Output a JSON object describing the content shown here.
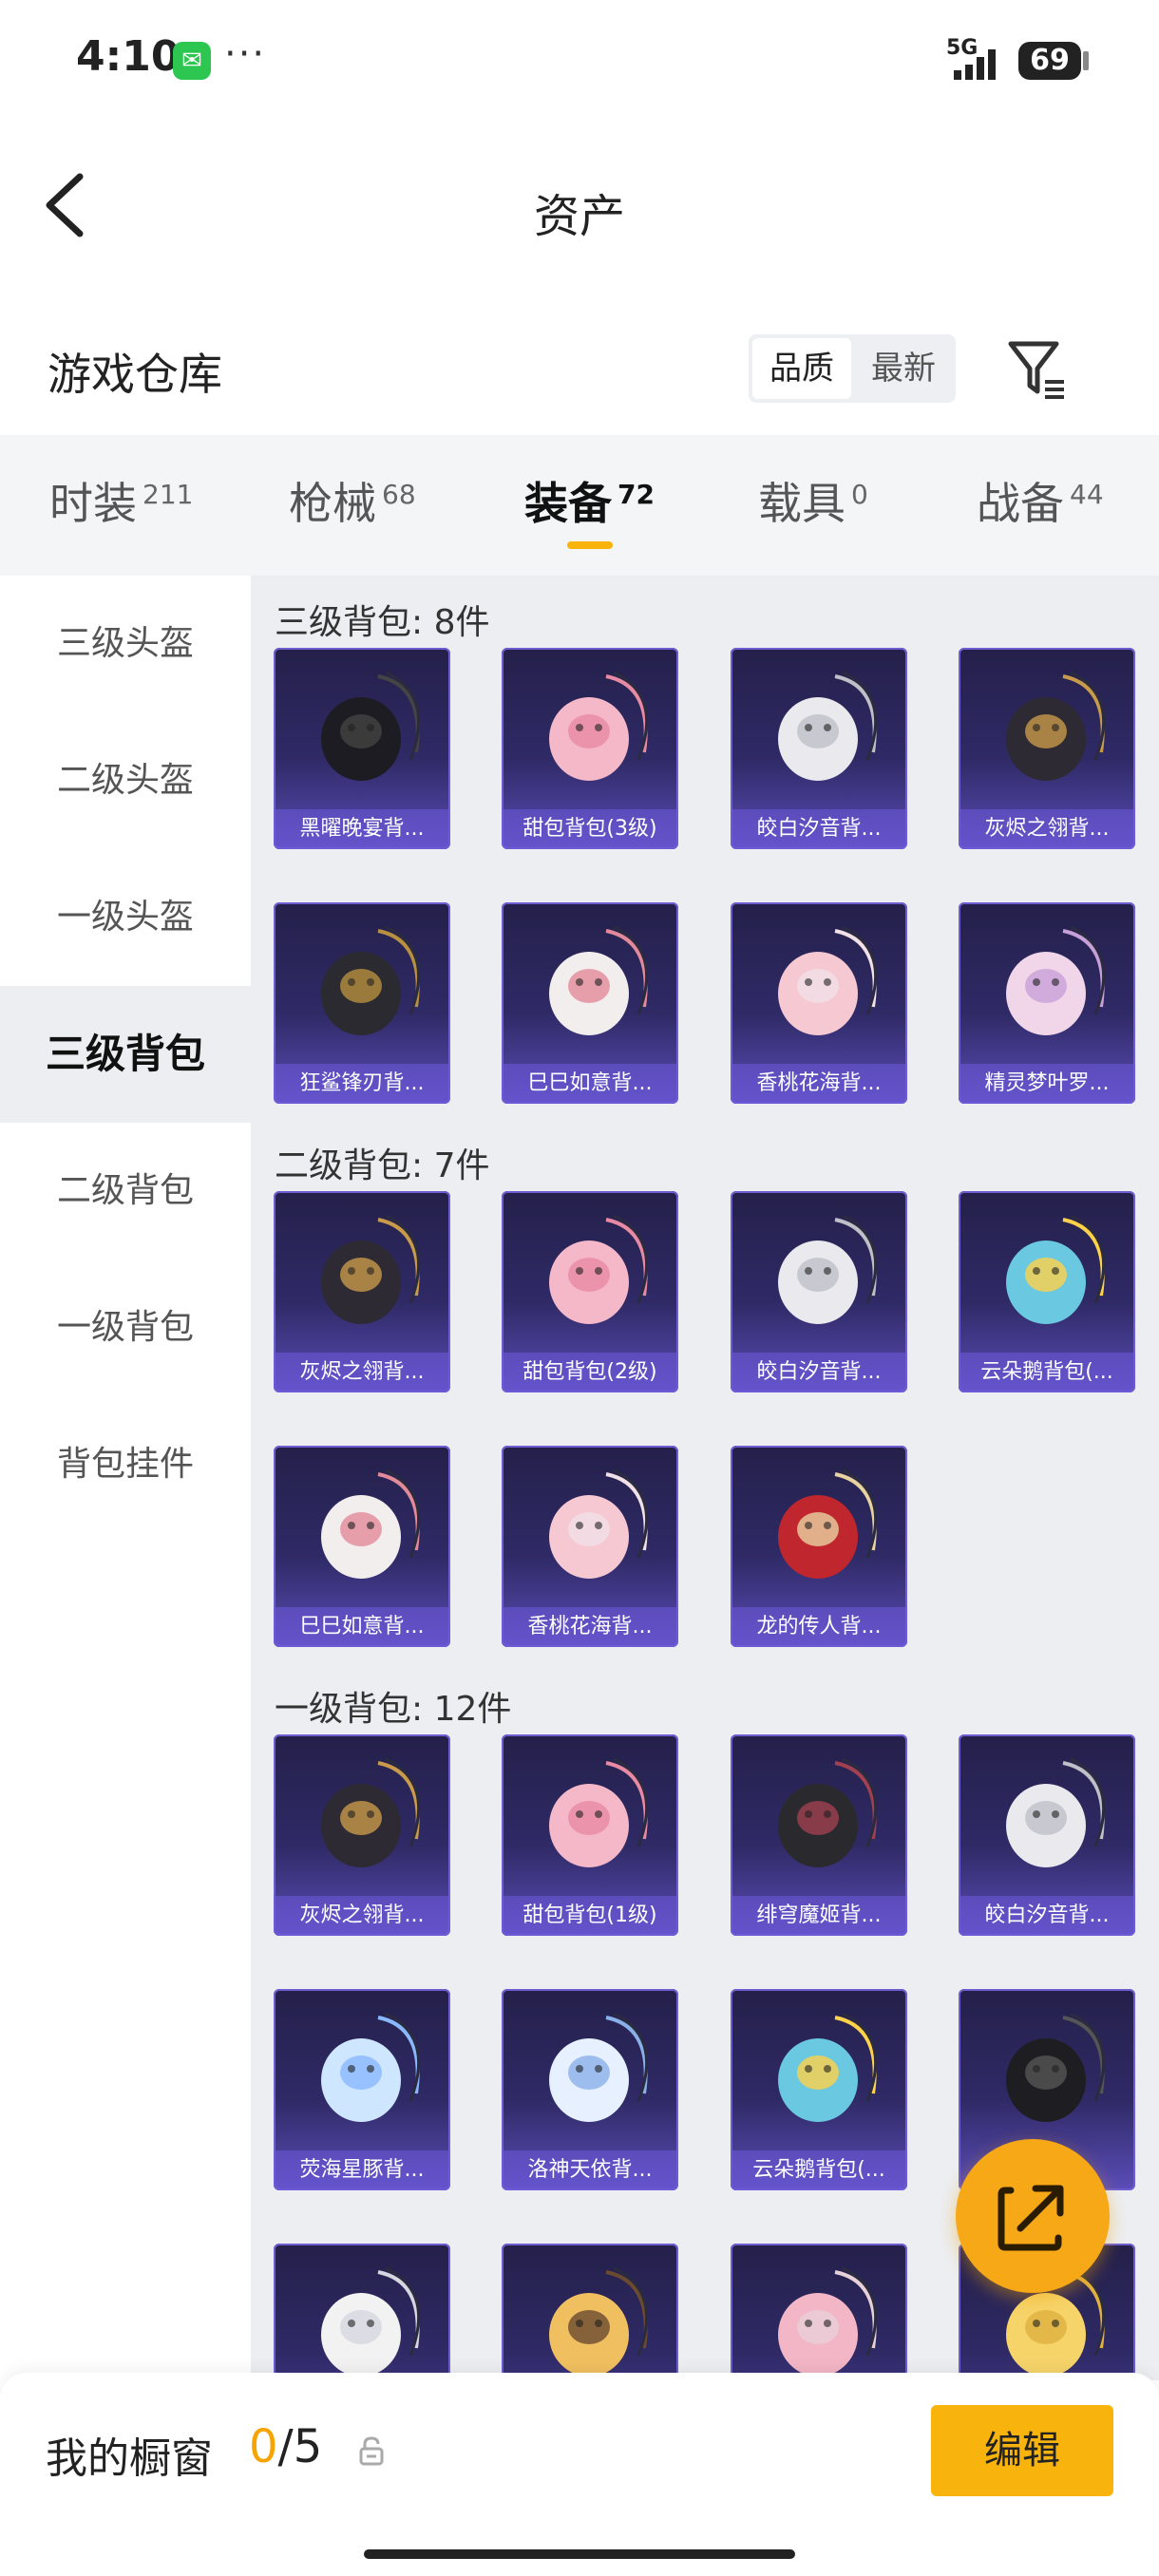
{
  "status_bar": {
    "time": "4:10",
    "network": "5G",
    "battery": "69"
  },
  "nav": {
    "title": "资产"
  },
  "warehouse": {
    "title": "游戏仓库",
    "sort_options": [
      "品质",
      "最新"
    ]
  },
  "tabs": [
    {
      "label": "时装",
      "count": "211"
    },
    {
      "label": "枪械",
      "count": "68"
    },
    {
      "label": "装备",
      "count": "72"
    },
    {
      "label": "载具",
      "count": "0"
    },
    {
      "label": "战备",
      "count": "44"
    }
  ],
  "sidebar": {
    "items": [
      "三级头盔",
      "二级头盔",
      "一级头盔",
      "三级背包",
      "二级背包",
      "一级背包",
      "背包挂件"
    ],
    "active": "三级背包"
  },
  "sections": [
    {
      "title": "三级背包: 8件",
      "items": [
        {
          "label": "黑曜晚宴背...",
          "icon": "black-dog-backpack-icon"
        },
        {
          "label": "甜包背包(3级)",
          "icon": "pink-bear-backpack-icon"
        },
        {
          "label": "皎白汐音背...",
          "icon": "white-shell-backpack-icon"
        },
        {
          "label": "灰烬之翎背...",
          "icon": "gold-emblem-backpack-icon"
        },
        {
          "label": "狂鲨锋刃背...",
          "icon": "shark-backpack-icon"
        },
        {
          "label": "巳巳如意背...",
          "icon": "white-snake-backpack-icon"
        },
        {
          "label": "香桃花海背...",
          "icon": "pink-flower-backpack-icon"
        },
        {
          "label": "精灵梦叶罗...",
          "icon": "fairy-heart-backpack-icon"
        }
      ]
    },
    {
      "title": "二级背包: 7件",
      "items": [
        {
          "label": "灰烬之翎背...",
          "icon": "gold-emblem-backpack-icon"
        },
        {
          "label": "甜包背包(2级)",
          "icon": "pink-bear-backpack-icon"
        },
        {
          "label": "皎白汐音背...",
          "icon": "white-shell-backpack-icon"
        },
        {
          "label": "云朵鹅背包(...",
          "icon": "cloud-goose-backpack-icon"
        },
        {
          "label": "巳巳如意背...",
          "icon": "white-snake-backpack-icon"
        },
        {
          "label": "香桃花海背...",
          "icon": "pink-flower-backpack-icon"
        },
        {
          "label": "龙的传人背...",
          "icon": "red-dragon-backpack-icon"
        }
      ]
    },
    {
      "title": "一级背包: 12件",
      "items": [
        {
          "label": "灰烬之翎背...",
          "icon": "gold-emblem-backpack-icon"
        },
        {
          "label": "甜包背包(1级)",
          "icon": "pink-bear-backpack-icon"
        },
        {
          "label": "绯穹魔姬背...",
          "icon": "dark-mask-backpack-icon"
        },
        {
          "label": "皎白汐音背...",
          "icon": "white-shell-backpack-icon"
        },
        {
          "label": "荧海星豚背...",
          "icon": "dolphin-backpack-icon"
        },
        {
          "label": "洛神天依背...",
          "icon": "blue-white-backpack-icon"
        },
        {
          "label": "云朵鹅背包(...",
          "icon": "cloud-goose-backpack-icon"
        },
        {
          "label": "",
          "icon": "black-box-backpack-icon"
        },
        {
          "label": "",
          "icon": "white-bunny-backpack-icon"
        },
        {
          "label": "",
          "icon": "yellow-chick-backpack-icon"
        },
        {
          "label": "",
          "icon": "pink-bunny-backpack-icon"
        },
        {
          "label": "",
          "icon": "yellow-backpack-icon"
        }
      ]
    }
  ],
  "bottom": {
    "label": "我的橱窗",
    "current": "0",
    "total": "/5",
    "edit_label": "编辑"
  },
  "colors": {
    "accent": "#f8b40d",
    "card_top": "#24204a",
    "card_bottom": "#5a4db8",
    "content_bg": "#eceef1"
  }
}
